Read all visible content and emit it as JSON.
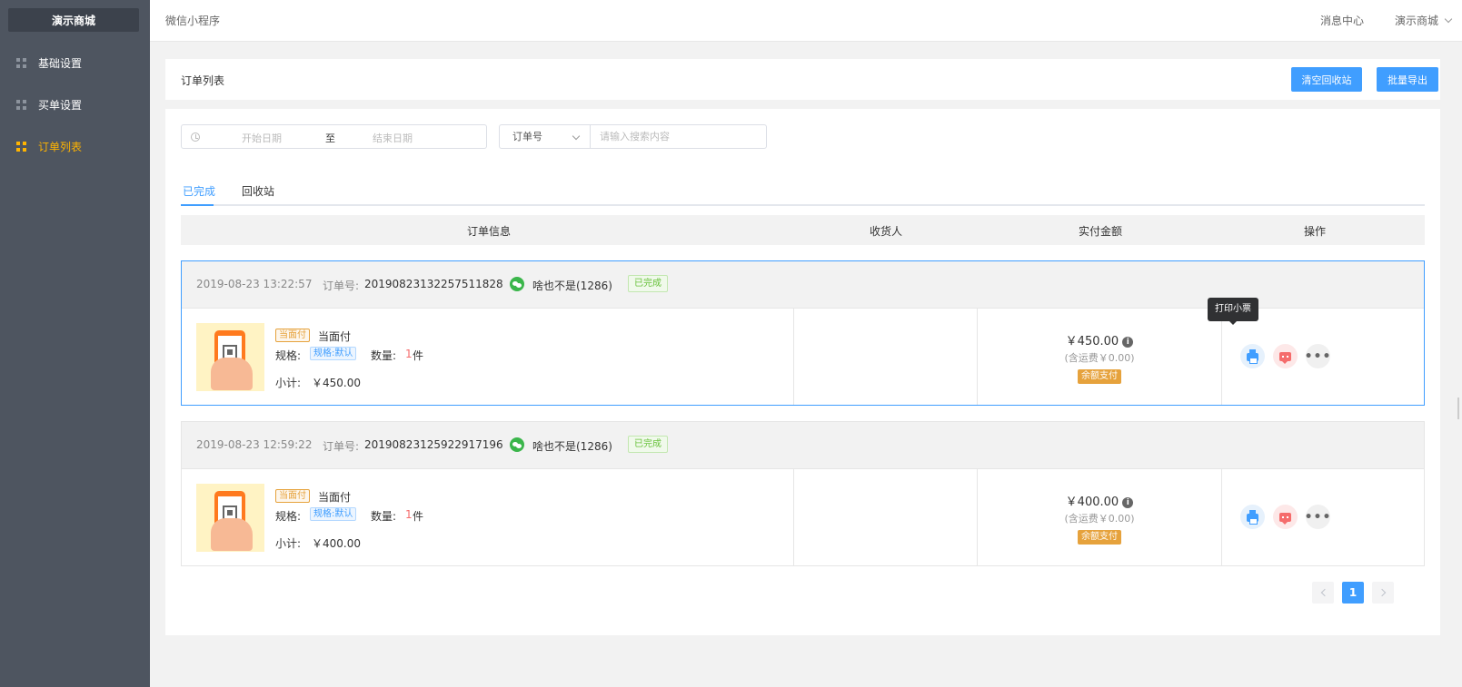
{
  "sidebar": {
    "brand": "演示商城",
    "items": [
      {
        "label": "基础设置",
        "active": false
      },
      {
        "label": "买单设置",
        "active": false
      },
      {
        "label": "订单列表",
        "active": true
      }
    ]
  },
  "topbar": {
    "crumb": "微信小程序",
    "message_center": "消息中心",
    "shop_menu": "演示商城"
  },
  "page_header": {
    "title": "订单列表",
    "clear_recycle_label": "清空回收站",
    "batch_export_label": "批量导出"
  },
  "filters": {
    "start_date_placeholder": "开始日期",
    "range_separator": "至",
    "end_date_placeholder": "结束日期",
    "search_type": "订单号",
    "search_placeholder": "请输入搜索内容"
  },
  "tabs": [
    {
      "label": "已完成",
      "active": true
    },
    {
      "label": "回收站",
      "active": false
    }
  ],
  "table_headers": [
    "订单信息",
    "收货人",
    "实付金额",
    "操作"
  ],
  "orders": [
    {
      "time": "2019-08-23 13:22:57",
      "order_no_label": "订单号:",
      "order_no": "20190823132257511828",
      "buyer": "啥也不是(1286)",
      "status": "已完成",
      "pay_type_tag": "当面付",
      "product_name": "当面付",
      "spec_label": "规格:",
      "spec_value": "规格:默认",
      "qty_label": "数量:",
      "qty_value": "1",
      "qty_unit": "件",
      "subtotal_label": "小计:",
      "subtotal": "￥450.00",
      "amount": "￥450.00",
      "shipping": "(含运费￥0.00)",
      "pay_method": "余额支付"
    },
    {
      "time": "2019-08-23 12:59:22",
      "order_no_label": "订单号:",
      "order_no": "20190823125922917196",
      "buyer": "啥也不是(1286)",
      "status": "已完成",
      "pay_type_tag": "当面付",
      "product_name": "当面付",
      "spec_label": "规格:",
      "spec_value": "规格:默认",
      "qty_label": "数量:",
      "qty_value": "1",
      "qty_unit": "件",
      "subtotal_label": "小计:",
      "subtotal": "￥400.00",
      "amount": "￥400.00",
      "shipping": "(含运费￥0.00)",
      "pay_method": "余额支付"
    }
  ],
  "tooltip": "打印小票",
  "pagination": {
    "current": "1"
  },
  "colors": {
    "sidebar_bg": "#4e5560",
    "accent": "#409eff",
    "active_nav": "#ffb400",
    "success": "#67c23a",
    "warning": "#e6a23c",
    "danger": "#f56c6c"
  },
  "icons": [
    "grid-icon",
    "clock-icon",
    "chevron-down-icon",
    "wechat-icon",
    "info-icon",
    "printer-icon",
    "message-icon",
    "more-icon",
    "arrow-left-icon",
    "arrow-right-icon"
  ]
}
